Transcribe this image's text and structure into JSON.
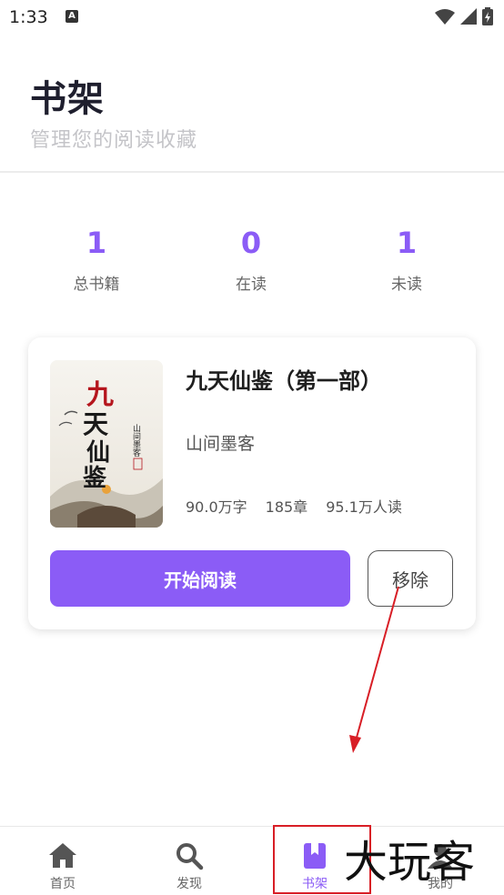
{
  "status_bar": {
    "time": "1:33",
    "notification_glyph": "A"
  },
  "header": {
    "title": "书架",
    "subtitle": "管理您的阅读收藏"
  },
  "stats": [
    {
      "value": "1",
      "label": "总书籍"
    },
    {
      "value": "0",
      "label": "在读"
    },
    {
      "value": "1",
      "label": "未读"
    }
  ],
  "book": {
    "title": "九天仙鉴（第一部）",
    "author": "山间墨客",
    "word_count": "90.0万字",
    "chapters": "185章",
    "readers": "95.1万人读",
    "cover_title": "九天仙鉴",
    "cover_author": "山间墨客 著"
  },
  "actions": {
    "read_label": "开始阅读",
    "remove_label": "移除"
  },
  "nav": {
    "items": [
      {
        "label": "首页",
        "icon": "home-icon"
      },
      {
        "label": "发现",
        "icon": "search-icon"
      },
      {
        "label": "书架",
        "icon": "bookmark-book-icon",
        "active": true
      },
      {
        "label": "我的",
        "icon": "person-icon"
      }
    ]
  },
  "watermark": {
    "text": "大玩客"
  },
  "colors": {
    "accent": "#8b5cf6",
    "annotation": "#d81e26"
  }
}
